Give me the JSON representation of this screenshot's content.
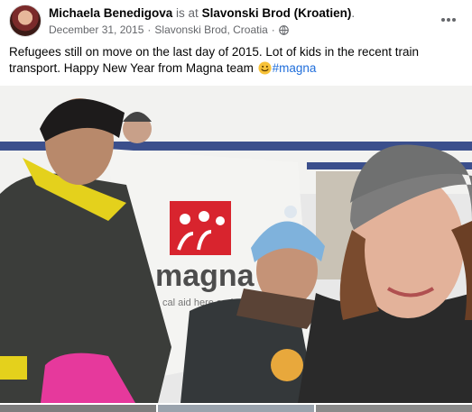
{
  "post": {
    "author": "Michaela Benedigova",
    "is_at": " is at ",
    "place": "Slavonski Brod (Kroatien)",
    "place_suffix": ".",
    "date": "December 31, 2015",
    "separator": " · ",
    "location": "Slavonski Brod, Croatia",
    "separator2": " · ",
    "audience_icon": "globe-icon",
    "text": "Refugees still on move on the last day of 2015. Lot of kids in the recent train transport. Happy New Year from Magna team ",
    "emoji": "smile-emoji",
    "hashtag": "#magna",
    "banner_text": "magna",
    "banner_subtext": "cal aid here and n"
  },
  "colors": {
    "link": "#216fdb",
    "secondary_text": "#65676b",
    "banner_red": "#d8242e"
  }
}
